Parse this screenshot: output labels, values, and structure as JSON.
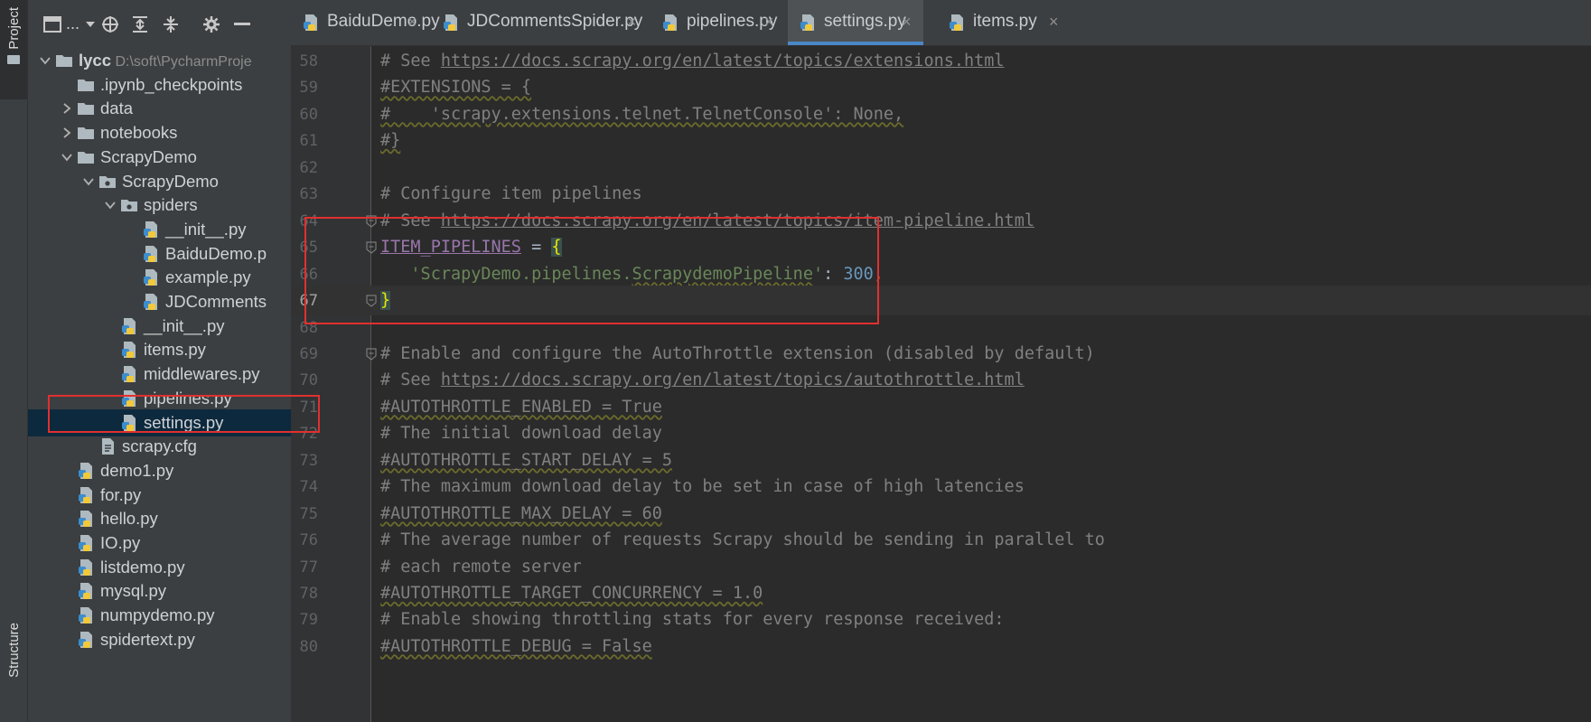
{
  "tool_strip": {
    "top_label": "Project",
    "bottom_label": "Structure"
  },
  "project_panel": {
    "view_label": "...",
    "tree": [
      {
        "label": "lycc",
        "path": "D:\\soft\\PycharmProje",
        "type": "folder-root",
        "expanded": true
      },
      {
        "label": ".ipynb_checkpoints",
        "type": "folder"
      },
      {
        "label": "data",
        "type": "folder",
        "expanded": false
      },
      {
        "label": "notebooks",
        "type": "folder",
        "expanded": false
      },
      {
        "label": "ScrapyDemo",
        "type": "folder",
        "expanded": true
      },
      {
        "label": "ScrapyDemo",
        "type": "package",
        "expanded": true
      },
      {
        "label": "spiders",
        "type": "package",
        "expanded": true
      },
      {
        "label": "__init__.py",
        "type": "python"
      },
      {
        "label": "BaiduDemo.p",
        "type": "python"
      },
      {
        "label": "example.py",
        "type": "python"
      },
      {
        "label": "JDComments",
        "type": "python"
      },
      {
        "label": "__init__.py",
        "type": "python"
      },
      {
        "label": "items.py",
        "type": "python"
      },
      {
        "label": "middlewares.py",
        "type": "python"
      },
      {
        "label": "pipelines.py",
        "type": "python"
      },
      {
        "label": "settings.py",
        "type": "python",
        "selected": true
      },
      {
        "label": "scrapy.cfg",
        "type": "file"
      },
      {
        "label": "demo1.py",
        "type": "python"
      },
      {
        "label": "for.py",
        "type": "python"
      },
      {
        "label": "hello.py",
        "type": "python"
      },
      {
        "label": "IO.py",
        "type": "python"
      },
      {
        "label": "listdemo.py",
        "type": "python"
      },
      {
        "label": "mysql.py",
        "type": "python"
      },
      {
        "label": "numpydemo.py",
        "type": "python"
      },
      {
        "label": "spidertext.py",
        "type": "python"
      }
    ]
  },
  "tabs": [
    {
      "label": "BaiduDemo.py",
      "active": false
    },
    {
      "label": "JDCommentsSpider.py",
      "active": false
    },
    {
      "label": "pipelines.py",
      "active": false
    },
    {
      "label": "settings.py",
      "active": true
    },
    {
      "label": "items.py",
      "active": false
    }
  ],
  "editor": {
    "lines": [
      {
        "n": "58",
        "text": "# See https://docs.scrapy.org/en/latest/topics/extensions.html"
      },
      {
        "n": "59",
        "text": "#EXTENSIONS = {"
      },
      {
        "n": "60",
        "text": "#    'scrapy.extensions.telnet.TelnetConsole': None,"
      },
      {
        "n": "61",
        "text": "#}"
      },
      {
        "n": "62",
        "text": ""
      },
      {
        "n": "63",
        "text": "# Configure item pipelines"
      },
      {
        "n": "64",
        "text": "# See https://docs.scrapy.org/en/latest/topics/item-pipeline.html"
      },
      {
        "n": "65",
        "text": "ITEM_PIPELINES = {"
      },
      {
        "n": "66",
        "text": "   'ScrapyDemo.pipelines.ScrapydemoPipeline': 300,"
      },
      {
        "n": "67",
        "text": "}"
      },
      {
        "n": "68",
        "text": ""
      },
      {
        "n": "69",
        "text": "# Enable and configure the AutoThrottle extension (disabled by default)"
      },
      {
        "n": "70",
        "text": "# See https://docs.scrapy.org/en/latest/topics/autothrottle.html"
      },
      {
        "n": "71",
        "text": "#AUTOTHROTTLE_ENABLED = True"
      },
      {
        "n": "72",
        "text": "# The initial download delay"
      },
      {
        "n": "73",
        "text": "#AUTOTHROTTLE_START_DELAY = 5"
      },
      {
        "n": "74",
        "text": "# The maximum download delay to be set in case of high latencies"
      },
      {
        "n": "75",
        "text": "#AUTOTHROTTLE_MAX_DELAY = 60"
      },
      {
        "n": "76",
        "text": "# The average number of requests Scrapy should be sending in parallel to"
      },
      {
        "n": "77",
        "text": "# each remote server"
      },
      {
        "n": "78",
        "text": "#AUTOTHROTTLE_TARGET_CONCURRENCY = 1.0"
      },
      {
        "n": "79",
        "text": "# Enable showing throttling stats for every response received:"
      },
      {
        "n": "80",
        "text": "#AUTOTHROTTLE_DEBUG = False"
      }
    ]
  },
  "colors": {
    "highlight_box": "#e0302f",
    "tab_active_underline": "#4a88c7",
    "selection": "#0d293e"
  }
}
